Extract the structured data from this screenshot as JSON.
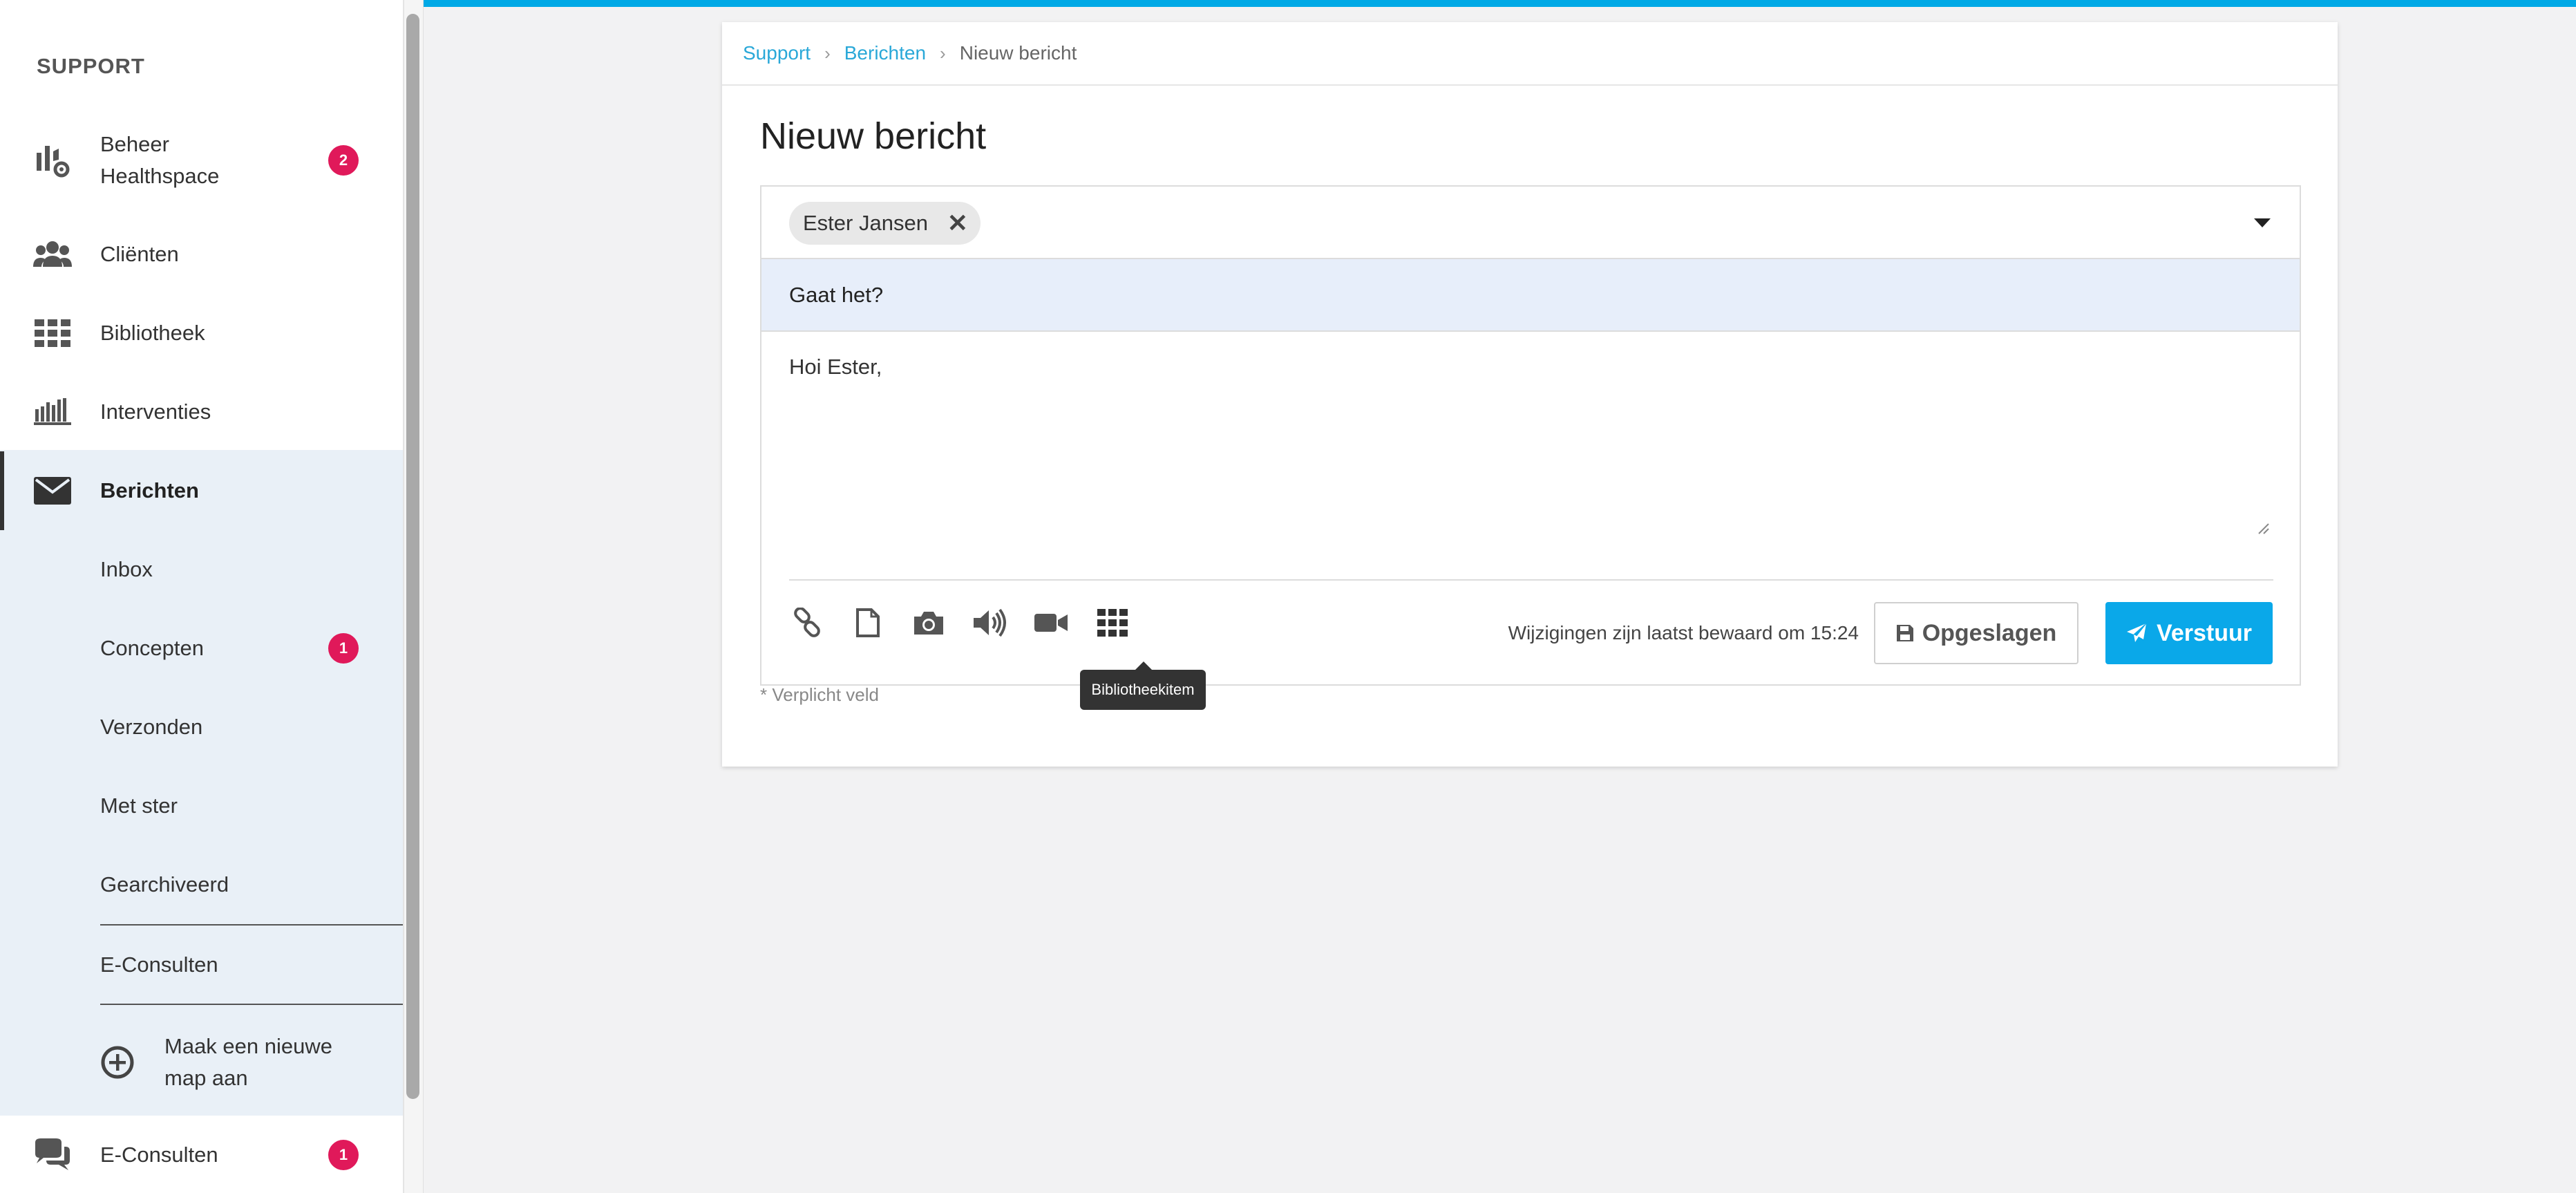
{
  "sidebar": {
    "header": "SUPPORT",
    "items": [
      {
        "label": "Beheer Healthspace",
        "badge": "2"
      },
      {
        "label": "Cliënten"
      },
      {
        "label": "Bibliotheek"
      },
      {
        "label": "Interventies"
      },
      {
        "label": "Berichten"
      }
    ],
    "sub_items": [
      {
        "label": "Inbox"
      },
      {
        "label": "Concepten",
        "badge": "1"
      },
      {
        "label": "Verzonden"
      },
      {
        "label": "Met ster"
      },
      {
        "label": "Gearchiveerd"
      },
      {
        "label": "E-Consulten"
      }
    ],
    "new_folder_label": "Maak een nieuwe map aan",
    "bottom_item": {
      "label": "E-Consulten",
      "badge": "1"
    }
  },
  "breadcrumb": {
    "items": [
      "Support",
      "Berichten"
    ],
    "current": "Nieuw bericht"
  },
  "page_title": "Nieuw bericht",
  "composer": {
    "recipient": "Ester Jansen",
    "subject": "Gaat het?",
    "body": "Hoi Ester,",
    "saved_status": "Wijzigingen zijn laatst bewaard om 15:24",
    "save_label": "Opgeslagen",
    "send_label": "Verstuur",
    "tooltip": "Bibliotheekitem",
    "toolbar_icons": [
      "link-icon",
      "file-icon",
      "camera-icon",
      "audio-icon",
      "video-icon",
      "library-grid-icon"
    ]
  },
  "required_note": "* Verplicht veld",
  "colors": {
    "accent": "#00a9e6",
    "badge": "#e0195a",
    "active_bg": "#e9f0f7",
    "subject_bg": "#e7eefa"
  }
}
